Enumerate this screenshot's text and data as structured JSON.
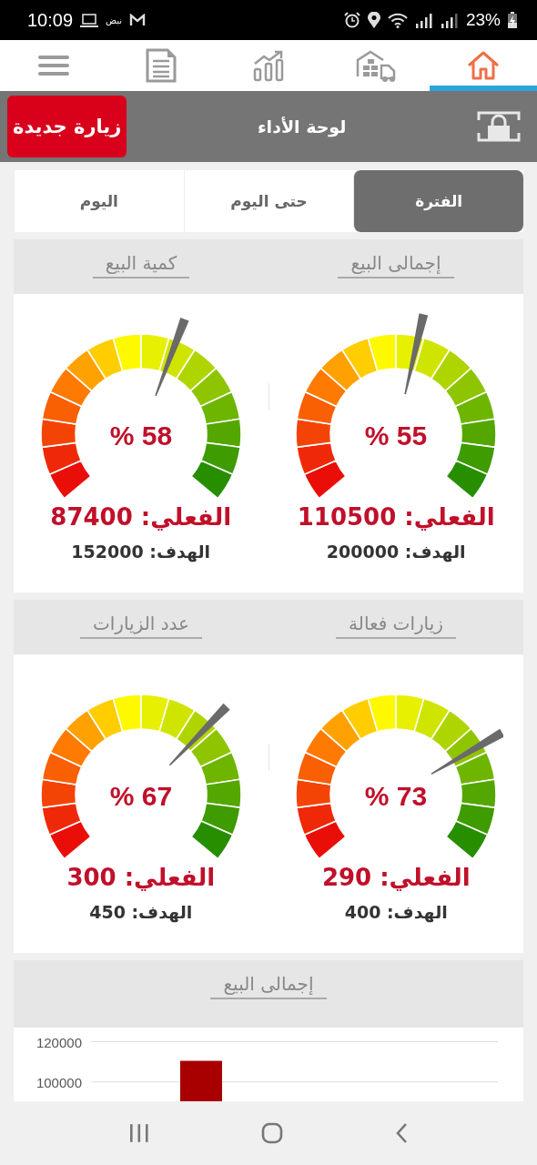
{
  "status_bar": {
    "time": "10:09",
    "notification_text": "نبض",
    "battery": "23%"
  },
  "nav_tabs": [
    {
      "kind": "menu",
      "selected": false
    },
    {
      "kind": "document",
      "selected": false
    },
    {
      "kind": "chart",
      "selected": false
    },
    {
      "kind": "warehouse",
      "selected": false
    },
    {
      "kind": "home",
      "selected": true
    }
  ],
  "header": {
    "title": "لوحة الأداء",
    "new_visit_button": "زيارة جديدة"
  },
  "period_tabs": [
    {
      "label": "الفترة",
      "selected": true
    },
    {
      "label": "حتى اليوم",
      "selected": false
    },
    {
      "label": "اليوم",
      "selected": false
    }
  ],
  "cards": [
    {
      "gauges": [
        {
          "title": "إجمالى البيع",
          "percent": "% 55",
          "actual": "الفعلي: 110500",
          "target": "الهدف: 200000"
        },
        {
          "title": "كمية البيع",
          "percent": "% 58",
          "actual": "الفعلي: 87400",
          "target": "الهدف: 152000"
        }
      ]
    },
    {
      "gauges": [
        {
          "title": "زيارات فعالة",
          "percent": "% 73",
          "actual": "الفعلي: 290",
          "target": "الهدف: 400"
        },
        {
          "title": "عدد الزيارات",
          "percent": "% 67",
          "actual": "الفعلي: 300",
          "target": "الهدف: 450"
        }
      ]
    }
  ],
  "chart_card": {
    "title": "إجمالى البيع",
    "chart_data": {
      "type": "bar",
      "values": [
        110500
      ],
      "ylim": [
        85000,
        120000
      ],
      "yticks": [
        100000,
        120000
      ]
    }
  }
}
